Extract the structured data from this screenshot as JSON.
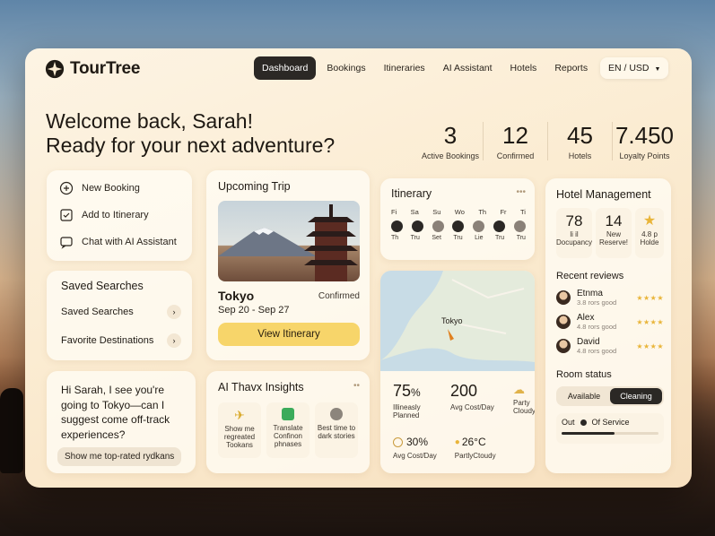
{
  "app": {
    "name": "TourTree"
  },
  "nav": {
    "items": [
      "Dashboard",
      "Bookings",
      "Itineraries",
      "AI Assistant",
      "Hotels",
      "Reports"
    ],
    "active": "Dashboard",
    "lang": "EN / USD"
  },
  "welcome": {
    "line1": "Welcome back, Sarah!",
    "line2": "Ready for your next adventure?"
  },
  "stats": [
    {
      "value": "3",
      "label": "Active Bookings"
    },
    {
      "value": "12",
      "label": "Confirmed"
    },
    {
      "value": "45",
      "label": "Hotels"
    },
    {
      "value": "7.450",
      "label": "Loyalty Points"
    }
  ],
  "quick_actions": [
    {
      "label": "New Booking",
      "icon": "plus-circle-icon"
    },
    {
      "label": "Add to Itinerary",
      "icon": "checkbox-icon"
    },
    {
      "label": "Chat with AI Assistant",
      "icon": "chat-icon"
    }
  ],
  "saved": {
    "title": "Saved Searches",
    "items": [
      "Saved Searches",
      "Favorite Destinations"
    ]
  },
  "ai_chat": {
    "message": "Hi Sarah, I see you're going to Tokyo—can I suggest come off-track experiences?",
    "chip": "Show me top-rated rydkans"
  },
  "trip": {
    "title": "Upcoming Trip",
    "city": "Tokyo",
    "status": "Confirmed",
    "dates": "Sep 20 - Sep 27",
    "button": "View Itinerary"
  },
  "insights": {
    "title": "AI Thavx Insights",
    "items": [
      {
        "label": "Show me regreated Tookans",
        "icon": "plane-icon"
      },
      {
        "label": "Translate Confinon phnases",
        "icon": "translate-icon"
      },
      {
        "label": "Best time to dark stories",
        "icon": "moon-icon"
      }
    ]
  },
  "itinerary": {
    "title": "Itinerary",
    "days": [
      "Fi",
      "Sa",
      "Su",
      "Wo",
      "Th",
      "Fr",
      "Ti"
    ],
    "bottom": [
      "Th",
      "Tru",
      "Set",
      "Tru",
      "Lie",
      "Tru",
      "Tru"
    ]
  },
  "map": {
    "label": "Tokyo"
  },
  "trip_stats": {
    "planned_value": "75",
    "planned_unit": "%",
    "planned_label": "Illineasly Planned",
    "cost_value": "200",
    "cost_label": "Avg Cost/Day",
    "weather_label": "Party Cloudy",
    "bottom_pct": "30%",
    "bottom_pct_label": "Avg Cost/Day",
    "bottom_temp": "26°C",
    "bottom_temp_label": "PartlyCtoudy"
  },
  "hotel": {
    "title": "Hotel Management",
    "tiles": [
      {
        "value": "78",
        "sub": "li il",
        "label": "Docupancy"
      },
      {
        "value": "14",
        "sub": "New",
        "label": "Reserve!"
      },
      {
        "value": "",
        "sub": "4.8 p",
        "label": "Holde"
      }
    ],
    "reviews_title": "Recent reviews",
    "reviews": [
      {
        "name": "Etnma",
        "sub": "3.8 rors good"
      },
      {
        "name": "Alex",
        "sub": "4.8 rors good"
      },
      {
        "name": "David",
        "sub": "4.8 rors good"
      }
    ],
    "room_title": "Room status",
    "room_tabs": [
      "Available",
      "Cleaning"
    ],
    "room_active": "Cleaning",
    "out_label": "Out",
    "service_label": "Of Service"
  },
  "colors": {
    "accent": "#f7d56a",
    "dark": "#2b2825",
    "star": "#e9b53a"
  }
}
